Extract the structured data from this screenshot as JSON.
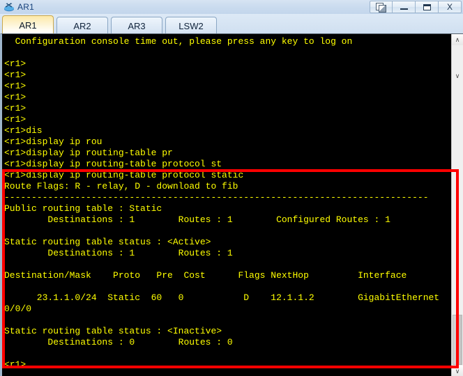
{
  "window": {
    "title": "AR1",
    "icon": "router-icon",
    "controls": [
      {
        "name": "restore-button",
        "label": ""
      },
      {
        "name": "minimize-button",
        "label": ""
      },
      {
        "name": "maximize-button",
        "label": ""
      },
      {
        "name": "close-button",
        "label": "X"
      }
    ]
  },
  "tabs": [
    {
      "label": "AR1",
      "active": true
    },
    {
      "label": "AR2",
      "active": false
    },
    {
      "label": "AR3",
      "active": false
    },
    {
      "label": "LSW2",
      "active": false
    }
  ],
  "terminal": {
    "prompt": "<r1>",
    "foreground": "#ffff00",
    "background": "#000000",
    "lines": [
      "  Configuration console time out, please press any key to log on",
      "",
      "<r1>",
      "<r1>",
      "<r1>",
      "<r1>",
      "<r1>",
      "<r1>",
      "<r1>dis",
      "<r1>display ip rou",
      "<r1>display ip routing-table pr",
      "<r1>display ip routing-table protocol st",
      "<r1>display ip routing-table protocol static",
      "Route Flags: R - relay, D - download to fib",
      "------------------------------------------------------------------------------",
      "Public routing table : Static",
      "        Destinations : 1        Routes : 1        Configured Routes : 1",
      "",
      "Static routing table status : <Active>",
      "        Destinations : 1        Routes : 1",
      "",
      "Destination/Mask    Proto   Pre  Cost      Flags NextHop         Interface",
      "",
      "      23.1.1.0/24  Static  60   0           D    12.1.1.2        GigabitEthernet",
      "0/0/0",
      "",
      "Static routing table status : <Inactive>",
      "        Destinations : 0        Routes : 0",
      "",
      "<r1>"
    ]
  },
  "routing_table": {
    "command": "display ip routing-table protocol static",
    "route_flags": "R - relay, D - download to fib",
    "public_table_name": "Public routing table : Static",
    "public_destinations": "1",
    "public_routes": "1",
    "public_configured_routes": "1",
    "active_status": "<Active>",
    "active_destinations": "1",
    "active_routes": "1",
    "columns": [
      "Destination/Mask",
      "Proto",
      "Pre",
      "Cost",
      "Flags",
      "NextHop",
      "Interface"
    ],
    "rows": [
      {
        "destination_mask": "23.1.1.0/24",
        "proto": "Static",
        "pre": "60",
        "cost": "0",
        "flags": "D",
        "next_hop": "12.1.1.2",
        "interface": "GigabitEthernet0/0/0"
      }
    ],
    "inactive_status": "<Inactive>",
    "inactive_destinations": "0",
    "inactive_routes": "0"
  },
  "scrollbar": {
    "up_arrow": "∧",
    "down_arrow": "∨",
    "mid_arrow": "∨"
  },
  "annotation": {
    "color": "#ff0000",
    "shape": "rectangle"
  }
}
